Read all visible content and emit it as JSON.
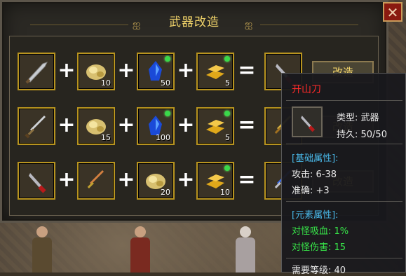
{
  "window": {
    "title": "武器改造",
    "close_label": "✕",
    "button_label": "改造"
  },
  "recipes": [
    {
      "inputs": [
        {
          "icon": "saber-icon",
          "count": "",
          "gem": false
        },
        {
          "icon": "gold-ore-icon",
          "count": "10",
          "gem": false
        },
        {
          "icon": "blue-crystal-icon",
          "count": "50",
          "gem": true
        },
        {
          "icon": "gold-bar-icon",
          "count": "5",
          "gem": true
        }
      ],
      "result_icon": "red-blade-icon"
    },
    {
      "inputs": [
        {
          "icon": "sword-icon",
          "count": "",
          "gem": false
        },
        {
          "icon": "gold-ore-icon",
          "count": "15",
          "gem": false
        },
        {
          "icon": "blue-crystal-icon",
          "count": "100",
          "gem": true
        },
        {
          "icon": "gold-bar-icon",
          "count": "5",
          "gem": true
        }
      ],
      "result_icon": "gold-blade-icon"
    },
    {
      "inputs": [
        {
          "icon": "red-blade-icon",
          "count": "",
          "gem": false
        },
        {
          "icon": "gold-blade-icon",
          "count": "",
          "gem": false
        },
        {
          "icon": "gold-ore-icon",
          "count": "20",
          "gem": false
        },
        {
          "icon": "gold-bar-icon",
          "count": "10",
          "gem": true
        }
      ],
      "result_icon": "blue-blade-icon"
    }
  ],
  "operators": {
    "plus": "+",
    "equals": "="
  },
  "tooltip": {
    "name": "开山刀",
    "type_line": "类型: 武器",
    "durability_line": "持久: 50/50",
    "base_section": "[基础属性]:",
    "attack_line": "攻击: 6-38",
    "accuracy_line": "准确: +3",
    "element_section": "[元素属性]:",
    "lifesteal_line": "对怪吸血: 1%",
    "monster_damage_line": "对怪伤害: 15",
    "level_line": "需要等级: 40"
  },
  "colors": {
    "title_gold": "#f2d46a",
    "slot_border": "#b8941f",
    "item_name_red": "#ff2a2a",
    "section_blue": "#49b8e8",
    "attr_green": "#38e84a"
  }
}
